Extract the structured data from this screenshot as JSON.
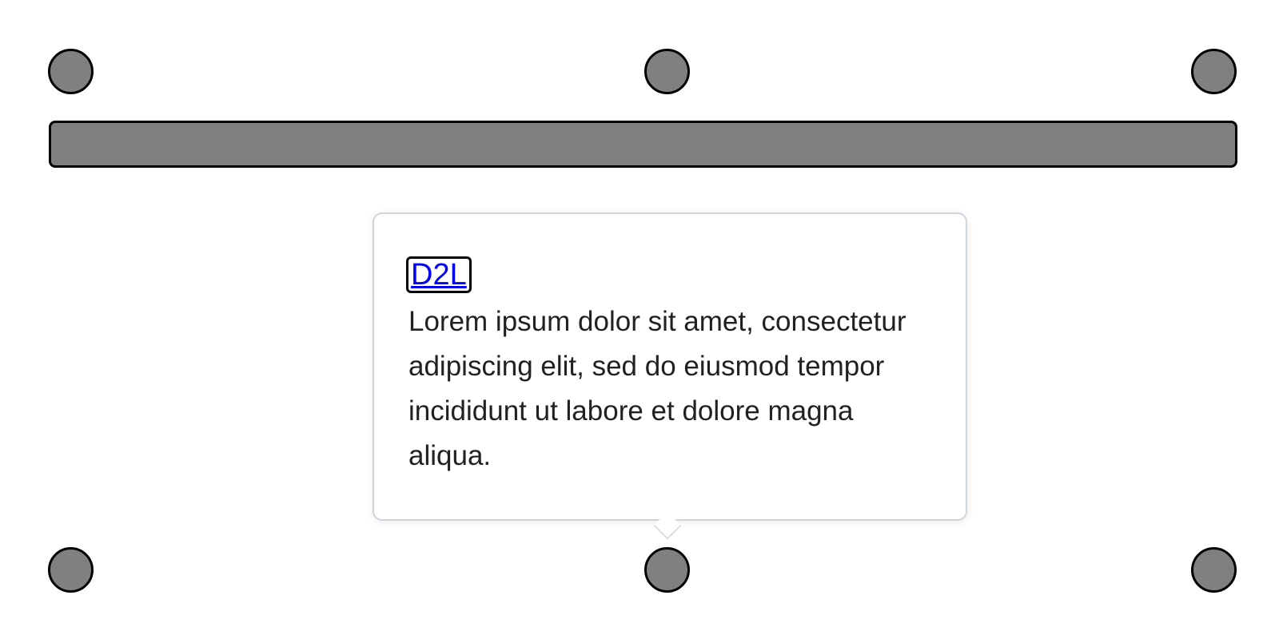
{
  "tooltip": {
    "link_label": "D2L",
    "body": "Lorem ipsum dolor sit amet, consectetur adipiscing elit, sed do eiusmod tempor incididunt ut labore et dolore magna aliqua."
  },
  "colors": {
    "anchor_fill": "#808080",
    "anchor_border": "#000000",
    "tooltip_border": "#cdd5dc",
    "link": "#0000ee",
    "text": "#202122"
  }
}
